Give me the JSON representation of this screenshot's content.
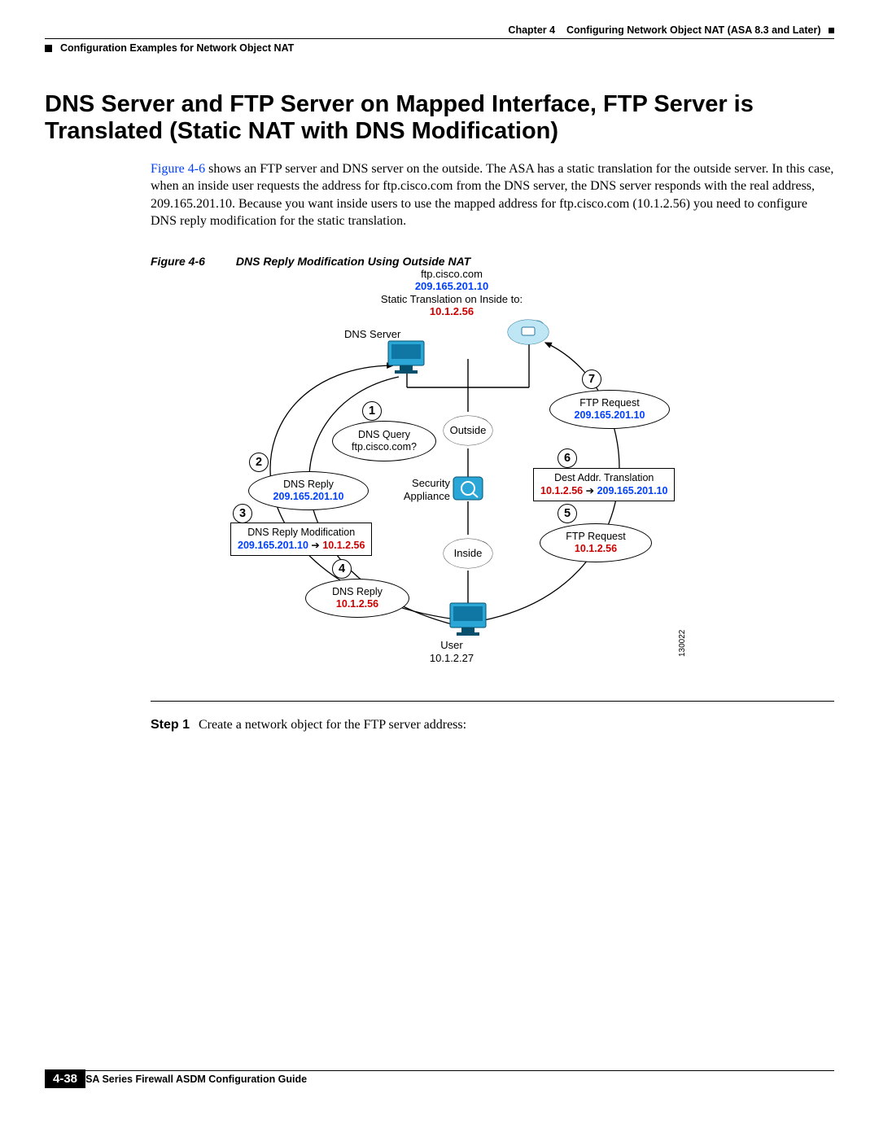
{
  "header": {
    "chapter": "Chapter 4",
    "chapter_title": "Configuring Network Object NAT (ASA 8.3 and Later)",
    "breadcrumb": "Configuration Examples for Network Object NAT"
  },
  "section_title": "DNS Server and FTP Server on Mapped Interface, FTP Server is Translated (Static NAT with DNS Modification)",
  "para": {
    "ref": "Figure 4-6",
    "text": " shows an FTP server and DNS server on the outside. The ASA has a static translation for the outside server. In this case, when an inside user requests the address for ftp.cisco.com from the DNS server, the DNS server responds with the real address, 209.165.201.10. Because you want inside users to use the mapped address for ftp.cisco.com (10.1.2.56) you need to configure DNS reply modification for the static translation."
  },
  "figure": {
    "label": "Figure 4-6",
    "caption": "DNS Reply Modification Using Outside NAT",
    "id": "130022"
  },
  "diagram": {
    "top": {
      "host": "ftp.cisco.com",
      "ip": "209.165.201.10",
      "trans_label": "Static Translation on Inside to:",
      "trans_ip": "10.1.2.56"
    },
    "dns_server_label": "DNS Server",
    "outside_label": "Outside",
    "inside_label": "Inside",
    "sec_app_label1": "Security",
    "sec_app_label2": "Appliance",
    "user_label": "User",
    "user_ip": "10.1.2.27",
    "steps": {
      "s1": "1",
      "s2": "2",
      "s3": "3",
      "s4": "4",
      "s5": "5",
      "s6": "6",
      "s7": "7"
    },
    "n1": {
      "l1": "DNS Query",
      "l2": "ftp.cisco.com?"
    },
    "n2": {
      "l1": "DNS Reply",
      "ip": "209.165.201.10"
    },
    "n3": {
      "l1": "DNS Reply Modification",
      "from": "209.165.201.10",
      "to": "10.1.2.56"
    },
    "n4": {
      "l1": "DNS Reply",
      "ip": "10.1.2.56"
    },
    "n5": {
      "l1": "FTP Request",
      "ip": "10.1.2.56"
    },
    "n6": {
      "l1": "Dest Addr. Translation",
      "from": "10.1.2.56",
      "to": "209.165.201.10"
    },
    "n7": {
      "l1": "FTP Request",
      "ip": "209.165.201.10"
    }
  },
  "step1": {
    "label": "Step 1",
    "text": "Create a network object for the FTP server address:"
  },
  "footer": {
    "doc_title": "Cisco ASA Series Firewall ASDM Configuration Guide",
    "page": "4-38"
  }
}
